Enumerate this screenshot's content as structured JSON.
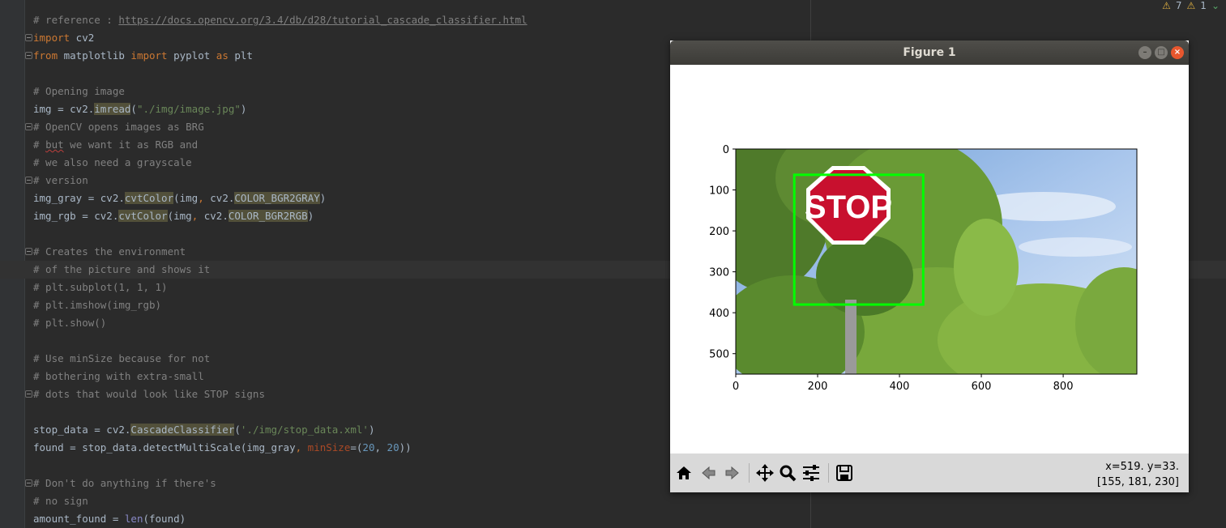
{
  "editor": {
    "code_lines": [
      [
        {
          "t": "# reference : ",
          "c": "cm"
        },
        {
          "t": "https://docs.opencv.org/3.4/db/d28/tutorial_cascade_classifier.html",
          "c": "url"
        }
      ],
      [
        {
          "t": "import",
          "c": "kw"
        },
        {
          "t": " cv2"
        }
      ],
      [
        {
          "t": "from",
          "c": "kw"
        },
        {
          "t": " matplotlib "
        },
        {
          "t": "import",
          "c": "kw"
        },
        {
          "t": " pyplot "
        },
        {
          "t": "as",
          "c": "kw"
        },
        {
          "t": " plt"
        }
      ],
      [],
      [
        {
          "t": "# Opening image",
          "c": "cm"
        }
      ],
      [
        {
          "t": "img = cv2."
        },
        {
          "t": "imread",
          "c": "hl"
        },
        {
          "t": "("
        },
        {
          "t": "\"./img/image.jpg\"",
          "c": "st"
        },
        {
          "t": ")"
        }
      ],
      [
        {
          "t": "# OpenCV opens images as BRG",
          "c": "cm"
        }
      ],
      [
        {
          "t": "# ",
          "c": "cm"
        },
        {
          "t": "but",
          "c": "cm squig"
        },
        {
          "t": " we want it as RGB and",
          "c": "cm"
        }
      ],
      [
        {
          "t": "# we also need a grayscale",
          "c": "cm"
        }
      ],
      [
        {
          "t": "# version",
          "c": "cm"
        }
      ],
      [
        {
          "t": "img_gray = cv2."
        },
        {
          "t": "cvtColor",
          "c": "hl"
        },
        {
          "t": "(img"
        },
        {
          "t": ",",
          "c": "kw"
        },
        {
          "t": " cv2."
        },
        {
          "t": "COLOR_BGR2GRAY",
          "c": "hl"
        },
        {
          "t": ")"
        }
      ],
      [
        {
          "t": "img_rgb = cv2."
        },
        {
          "t": "cvtColor",
          "c": "hl"
        },
        {
          "t": "(img"
        },
        {
          "t": ",",
          "c": "kw"
        },
        {
          "t": " cv2."
        },
        {
          "t": "COLOR_BGR2RGB",
          "c": "hl"
        },
        {
          "t": ")"
        }
      ],
      [],
      [
        {
          "t": "# Creates the environment",
          "c": "cm"
        }
      ],
      [
        {
          "t": "# of the picture and shows it",
          "c": "cm"
        }
      ],
      [
        {
          "t": "# plt.subplot(1, 1, 1)",
          "c": "cm"
        }
      ],
      [
        {
          "t": "# plt.imshow(img_rgb)",
          "c": "cm"
        }
      ],
      [
        {
          "t": "# plt.show()",
          "c": "cm"
        }
      ],
      [],
      [
        {
          "t": "# Use minSize because for not",
          "c": "cm"
        }
      ],
      [
        {
          "t": "# bothering with extra-small",
          "c": "cm"
        }
      ],
      [
        {
          "t": "# dots that would look like STOP signs",
          "c": "cm"
        }
      ],
      [],
      [
        {
          "t": "stop_data = cv2."
        },
        {
          "t": "CascadeClassifier",
          "c": "hl"
        },
        {
          "t": "("
        },
        {
          "t": "'./img/stop_data.xml'",
          "c": "st"
        },
        {
          "t": ")"
        }
      ],
      [
        {
          "t": "found = stop_data.detectMultiScale(img_gray"
        },
        {
          "t": ",",
          "c": "kw"
        },
        {
          "t": " "
        },
        {
          "t": "minSize",
          "c": "pn"
        },
        {
          "t": "=("
        },
        {
          "t": "20",
          "c": "nm"
        },
        {
          "t": ","
        },
        {
          "t": " "
        },
        {
          "t": "20",
          "c": "nm"
        },
        {
          "t": "))"
        }
      ],
      [],
      [
        {
          "t": "# Don't do anything if there's",
          "c": "cm"
        }
      ],
      [
        {
          "t": "# no sign",
          "c": "cm"
        }
      ],
      [
        {
          "t": "amount_found = "
        },
        {
          "t": "len",
          "c": "bi"
        },
        {
          "t": "(found)"
        }
      ]
    ],
    "inspections": {
      "warnings": "7",
      "weak_warnings": "1"
    }
  },
  "figure": {
    "title": "Figure 1",
    "status_xy": "x=519. y=33.",
    "status_rgb": "[155, 181, 230]",
    "toolbar": [
      "home-icon",
      "back-icon",
      "forward-icon",
      "pan-icon",
      "zoom-icon",
      "configure-subplots-icon",
      "save-icon"
    ],
    "stop_sign_text": "STOP",
    "box_color": "#00ff00"
  },
  "chart_data": {
    "type": "image",
    "title": "",
    "xlabel": "",
    "ylabel": "",
    "xlim": [
      0,
      980
    ],
    "ylim": [
      550,
      0
    ],
    "xticks": [
      0,
      200,
      400,
      600,
      800
    ],
    "yticks": [
      0,
      100,
      200,
      300,
      400,
      500
    ],
    "detection_box": {
      "x0": 143,
      "y0": 63,
      "x1": 458,
      "y1": 380
    }
  }
}
